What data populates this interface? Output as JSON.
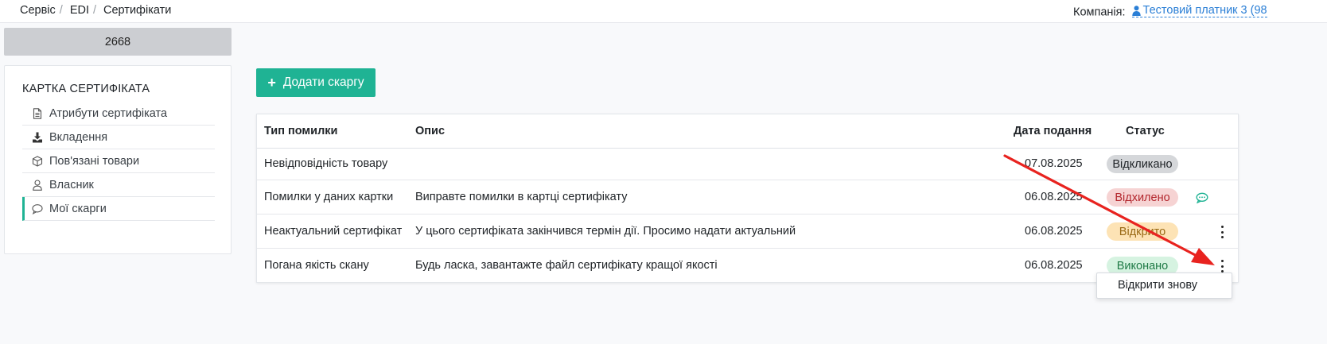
{
  "breadcrumb": [
    "Сервіс",
    "EDI",
    "Сертифікати"
  ],
  "company": {
    "label": "Компанія:",
    "name": "Тестовий платник 3 (98"
  },
  "certificate_number": "2668",
  "sidebar": {
    "title": "КАРТКА СЕРТИФІКАТА",
    "items": [
      {
        "label": "Атрибути сертифіката",
        "icon": "document-icon",
        "active": false
      },
      {
        "label": "Вкладення",
        "icon": "download-icon",
        "active": false
      },
      {
        "label": "Пов'язані товари",
        "icon": "box-icon",
        "active": false
      },
      {
        "label": "Власник",
        "icon": "user-icon",
        "active": false
      },
      {
        "label": "Мої скарги",
        "icon": "chat-icon",
        "active": true
      }
    ]
  },
  "add_button": {
    "label": "Додати скаргу"
  },
  "table": {
    "headers": {
      "type": "Тип помилки",
      "description": "Опис",
      "date": "Дата подання",
      "status": "Статус"
    },
    "rows": [
      {
        "type": "Невідповідність товару",
        "description": "",
        "date": "07.08.2025",
        "status": "Відкликано",
        "status_bg": "#d5d7da",
        "status_fg": "#212529",
        "action": "none"
      },
      {
        "type": "Помилки у даних картки",
        "description": "Виправте помилки в картці сертифікату",
        "date": "06.08.2025",
        "status": "Відхилено",
        "status_bg": "#f6d3d3",
        "status_fg": "#b3262d",
        "action": "chat-icon"
      },
      {
        "type": "Неактуальний сертифікат",
        "description": "У цього сертифіката закінчився термін дії. Просимо надати актуальний",
        "date": "06.08.2025",
        "status": "Відкрито",
        "status_bg": "#fde3b5",
        "status_fg": "#9a6a15",
        "action": "kebab-icon"
      },
      {
        "type": "Погана якість скану",
        "description": "Будь ласка, завантажте файл сертифікату кращої якості",
        "date": "06.08.2025",
        "status": "Виконано",
        "status_bg": "#d6f3e1",
        "status_fg": "#1f7a46",
        "action": "kebab-icon"
      }
    ]
  },
  "dropdown": {
    "items": [
      "Відкрити знову"
    ]
  },
  "colors": {
    "accent": "#1fb394",
    "link": "#2b7fd6",
    "annotation_arrow": "#e8231f"
  }
}
